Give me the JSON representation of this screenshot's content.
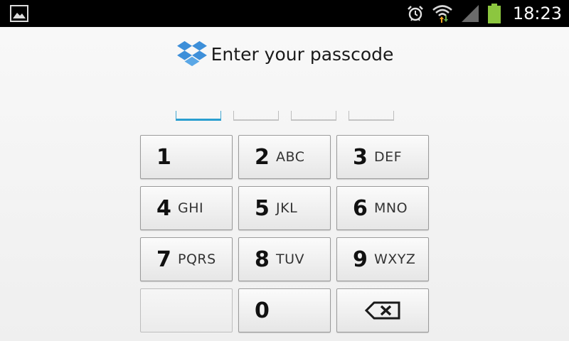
{
  "status_bar": {
    "time": "18:23",
    "icons": [
      "gallery-icon",
      "alarm-icon",
      "wifi-icon",
      "signal-icon",
      "battery-icon"
    ],
    "battery_color": "#8cc63f",
    "wifi_up_arrow_color": "#f5a623",
    "wifi_down_arrow_color": "#6ab04c"
  },
  "header": {
    "logo": "dropbox-logo-icon",
    "title": "Enter your passcode",
    "logo_color": "#3d8fd9"
  },
  "passcode": {
    "slots": 4,
    "filled": 0,
    "active_index": 0,
    "accent_color": "#2a9fd0"
  },
  "keypad": {
    "keys": [
      {
        "digit": "1",
        "letters": ""
      },
      {
        "digit": "2",
        "letters": "ABC"
      },
      {
        "digit": "3",
        "letters": "DEF"
      },
      {
        "digit": "4",
        "letters": "GHI"
      },
      {
        "digit": "5",
        "letters": "JKL"
      },
      {
        "digit": "6",
        "letters": "MNO"
      },
      {
        "digit": "7",
        "letters": "PQRS"
      },
      {
        "digit": "8",
        "letters": "TUV"
      },
      {
        "digit": "9",
        "letters": "WXYZ"
      },
      {
        "digit": "",
        "letters": ""
      },
      {
        "digit": "0",
        "letters": ""
      },
      {
        "digit": "",
        "letters": "",
        "icon": "backspace-icon"
      }
    ]
  }
}
